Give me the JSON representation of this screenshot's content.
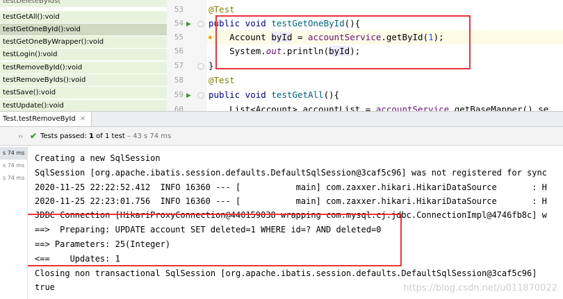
{
  "structure": {
    "items": [
      {
        "label": "testDeleteByIds(",
        "partial": true
      },
      {
        "label": "testGetAll():void"
      },
      {
        "label": "testGetOneById():void",
        "selected": true
      },
      {
        "label": "testGetOneByWrapper():void"
      },
      {
        "label": "testLogin():void"
      },
      {
        "label": "testRemoveById():void"
      },
      {
        "label": "testRemoveByIds():void"
      },
      {
        "label": "testSave():void"
      },
      {
        "label": "testUpdate():void"
      }
    ]
  },
  "editor": {
    "line_numbers": [
      "53",
      "54",
      "55",
      "56",
      "57",
      "58",
      "59",
      "60"
    ],
    "lines": [
      {
        "segments": [
          {
            "t": "@Test",
            "c": "ann"
          }
        ]
      },
      {
        "segments": [
          {
            "t": "public void ",
            "c": "kw"
          },
          {
            "t": "testGetOneById",
            "c": "fn"
          },
          {
            "t": "(){",
            "c": ""
          }
        ]
      },
      {
        "segments": [
          {
            "t": "    Account ",
            "c": ""
          },
          {
            "t": "byId",
            "c": "varbg"
          },
          {
            "t": " = ",
            "c": ""
          },
          {
            "t": "accountService",
            "c": "field"
          },
          {
            "t": ".getById(",
            "c": ""
          },
          {
            "t": "1",
            "c": "num"
          },
          {
            "t": ");",
            "c": ""
          }
        ]
      },
      {
        "segments": [
          {
            "t": "    System.",
            "c": ""
          },
          {
            "t": "out",
            "c": "static"
          },
          {
            "t": ".println(",
            "c": ""
          },
          {
            "t": "byId",
            "c": "varbg"
          },
          {
            "t": ");",
            "c": ""
          }
        ]
      },
      {
        "segments": [
          {
            "t": "}",
            "c": ""
          }
        ]
      },
      {
        "segments": [
          {
            "t": "@Test",
            "c": "ann"
          }
        ]
      },
      {
        "segments": [
          {
            "t": "public void ",
            "c": "kw"
          },
          {
            "t": "testGetAll",
            "c": "fn"
          },
          {
            "t": "(){",
            "c": ""
          }
        ]
      },
      {
        "segments": [
          {
            "t": "    List<Account> accountList = ",
            "c": ""
          },
          {
            "t": "accountService",
            "c": "field"
          },
          {
            "t": ".getBaseMapper().se",
            "c": ""
          }
        ]
      }
    ]
  },
  "run": {
    "tab_label": "Test.testRemoveById",
    "status_bold": "Tests passed: ",
    "status_count": "1",
    "status_rest": " of 1 test",
    "status_time": " – 43 s 74 ms",
    "times": [
      "s 74 ms",
      "s 74 ms",
      "s 74 ms"
    ]
  },
  "console": {
    "lines": [
      "Creating a new SqlSession",
      "SqlSession [org.apache.ibatis.session.defaults.DefaultSqlSession@3caf5c96] was not registered for sync",
      "2020-11-25 22:22:52.412  INFO 16360 --- [           main] com.zaxxer.hikari.HikariDataSource       : H",
      "2020-11-25 22:23:01.756  INFO 16360 --- [           main] com.zaxxer.hikari.HikariDataSource       : H",
      "JDBC Connection [HikariProxyConnection@440159038 wrapping com.mysql.cj.jdbc.ConnectionImpl@4746fb8c] w",
      "==>  Preparing: UPDATE account SET deleted=1 WHERE id=? AND deleted=0",
      "==> Parameters: 25(Integer)",
      "<==    Updates: 1",
      "Closing non transactional SqlSession [org.apache.ibatis.session.defaults.DefaultSqlSession@3caf5c96]",
      "true"
    ],
    "watermark": "https://blog.csdn.net/u011870022"
  },
  "icons": {
    "run": "run-gutter-icon",
    "fold": "fold-icon",
    "bulb": "lightbulb-icon",
    "check": "check-icon",
    "chevron": "chevron-right-icon",
    "close": "close-icon"
  },
  "colors": {
    "highlight": "#e8323b",
    "test_passed": "#3a9a3a",
    "structure_bg": "#e8f3dd"
  }
}
